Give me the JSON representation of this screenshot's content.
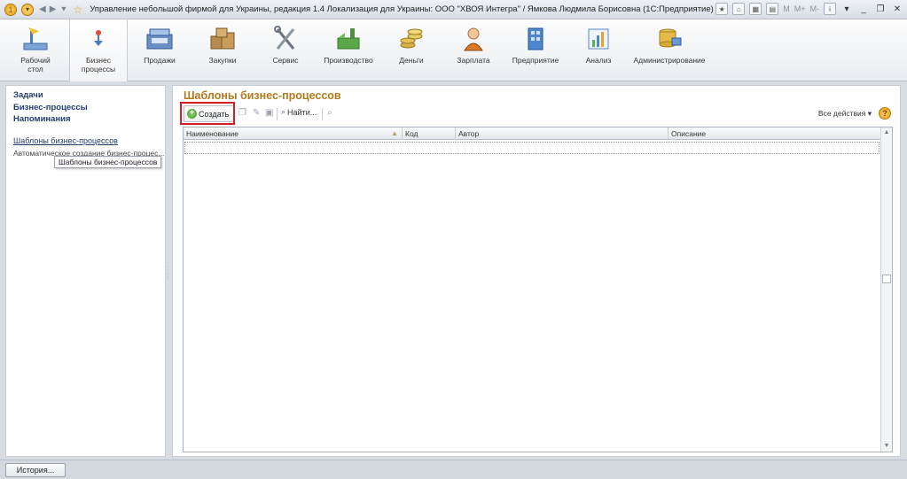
{
  "titlebar": {
    "title": "Управление небольшой фирмой для Украины, редакция 1.4 Локализация для Украины: ООО \"ХВОЯ Интегра\" / Ямкова Людмила Борисовна  (1С:Предприятие)",
    "m_label": "M",
    "mplus_label": "M+",
    "mminus_label": "M-"
  },
  "sections": [
    {
      "label": "Рабочий стол",
      "icon": "desktop-icon"
    },
    {
      "label": "Бизнес процессы",
      "icon": "business-process-icon"
    },
    {
      "label": "Продажи",
      "icon": "cash-register-icon"
    },
    {
      "label": "Закупки",
      "icon": "boxes-icon"
    },
    {
      "label": "Сервис",
      "icon": "tools-icon"
    },
    {
      "label": "Производство",
      "icon": "factory-icon"
    },
    {
      "label": "Деньги",
      "icon": "coins-icon"
    },
    {
      "label": "Зарплата",
      "icon": "worker-icon"
    },
    {
      "label": "Предприятие",
      "icon": "building-icon"
    },
    {
      "label": "Анализ",
      "icon": "chart-icon"
    },
    {
      "label": "Администрирование",
      "icon": "admin-icon"
    }
  ],
  "leftnav": {
    "items": [
      "Задачи",
      "Бизнес-процессы",
      "Напоминания"
    ],
    "link": "Шаблоны бизнес-процессов",
    "plain": "Автоматическое создание бизнес-процес...",
    "tooltip": "Шаблоны бизнес-процессов"
  },
  "main": {
    "title": "Шаблоны бизнес-процессов",
    "create_label": "Создать",
    "find_label": "Найти...",
    "all_actions": "Все действия",
    "help": "?",
    "columns": [
      "Наименование",
      "Код",
      "Автор",
      "Описание"
    ]
  },
  "status": {
    "history_label": "История..."
  },
  "colors": {
    "title_accent": "#b5791b",
    "nav_link": "#1f3c6b",
    "highlight": "#d21e24"
  }
}
